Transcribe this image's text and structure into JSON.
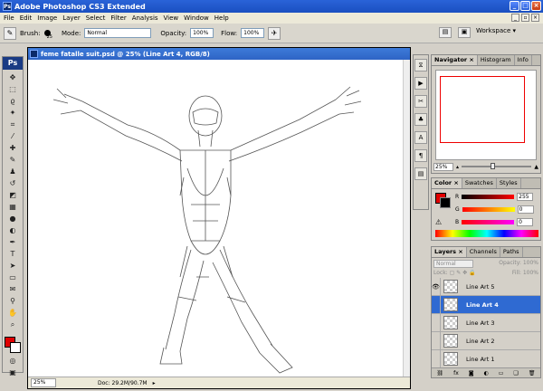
{
  "window": {
    "title": "Adobe Photoshop CS3 Extended",
    "app_icon": "Ps"
  },
  "menu": [
    "File",
    "Edit",
    "Image",
    "Layer",
    "Select",
    "Filter",
    "Analysis",
    "View",
    "Window",
    "Help"
  ],
  "options": {
    "brush_label": "Brush:",
    "brush_size": "25",
    "mode_label": "Mode:",
    "mode_value": "Normal",
    "opacity_label": "Opacity:",
    "opacity_value": "100%",
    "flow_label": "Flow:",
    "flow_value": "100%",
    "workspace_label": "Workspace ▾"
  },
  "toolbox": {
    "logo": "Ps"
  },
  "document": {
    "title": "feme fatalle suit.psd @ 25% (Line Art 4, RGB/8)",
    "zoom": "25%",
    "doc_info": "Doc: 29.2M/90.7M"
  },
  "navigator": {
    "tabs": [
      "Navigator ×",
      "Histogram",
      "Info"
    ],
    "zoom": "25%"
  },
  "color_panel": {
    "tabs": [
      "Color ×",
      "Swatches",
      "Styles"
    ],
    "channels": [
      {
        "label": "R",
        "value": "255",
        "gradient": "linear-gradient(90deg,#000,#f00)"
      },
      {
        "label": "G",
        "value": "0",
        "gradient": "linear-gradient(90deg,#f00,#ff0)"
      },
      {
        "label": "B",
        "value": "0",
        "gradient": "linear-gradient(90deg,#f00,#f0f)"
      }
    ],
    "foreground": "#e00000",
    "background": "#000000"
  },
  "layers_panel": {
    "tabs": [
      "Layers ×",
      "Channels",
      "Paths"
    ],
    "blend_mode": "Normal",
    "opacity_label": "Opacity:",
    "opacity_value": "100%",
    "lock_label": "Lock:",
    "fill_label": "Fill:",
    "fill_value": "100%",
    "layers": [
      {
        "name": "Line Art 5",
        "visible": true,
        "selected": false
      },
      {
        "name": "Line Art 4",
        "visible": false,
        "selected": true
      },
      {
        "name": "Line Art 3",
        "visible": false,
        "selected": false
      },
      {
        "name": "Line Art 2",
        "visible": false,
        "selected": false
      },
      {
        "name": "Line Art 1",
        "visible": false,
        "selected": false
      }
    ]
  }
}
